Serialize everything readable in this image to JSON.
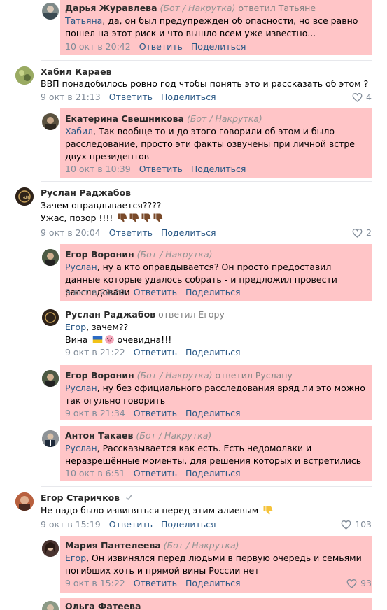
{
  "comments": [
    {
      "author": "Дарья Журавлева",
      "bot_tag": "(Бот / Накрутка)",
      "replied": "ответил Татьяне",
      "mention": "Татьяна",
      "text": ", да, он был предупрежден об опасности, но все равно пошел на этот риск и что вышло всем уже известно...",
      "date": "10 окт в 20:42",
      "reply": "Ответить",
      "share": "Поделиться"
    },
    {
      "author": "Хабил Караев",
      "text": "ВВП понадобилось ровно год чтобы понять это и рассказать об этом ?",
      "date": "9 окт в 21:13",
      "reply": "Ответить",
      "share": "Поделиться",
      "likes": "4"
    },
    {
      "author": "Екатерина Свешникова",
      "bot_tag": "(Бот / Накрутка)",
      "mention": "Хабил",
      "text": ", Так вообще то и до этого говорили об этом и было расследование, просто эти факты озвучены при личной встре двух президентов",
      "date": "10 окт в 10:39",
      "reply": "Ответить",
      "share": "Поделиться"
    },
    {
      "author": "Руслан Раджабов",
      "text_line1": "Зачем оправдывается????",
      "text_line2": "Ужас, позор !!!! ",
      "date": "9 окт в 20:04",
      "reply": "Ответить",
      "share": "Поделиться",
      "likes": "2"
    },
    {
      "author": "Егор Воронин",
      "bot_tag": "(Бот / Накрутка)",
      "mention": "Руслан",
      "text": ", ну а кто оправдывается? Он просто предоставил данные которые удалось собрать - и предложил провести расследовани",
      "date": "9 окт в 20:20",
      "reply": "Ответить",
      "share": "Поделиться"
    },
    {
      "author": "Руслан Раджабов",
      "replied": "ответил Егору",
      "mention": "Егор",
      "text_line1": ", зачем??",
      "text_line2a": "Вина ",
      "text_line2b": " очевидна!!!",
      "date": "9 окт в 21:22",
      "reply": "Ответить",
      "share": "Поделиться"
    },
    {
      "author": "Егор Воронин",
      "bot_tag": "(Бот / Накрутка)",
      "replied": "ответил Руслану",
      "mention": "Руслан",
      "text": ", ну без официального расследования вряд ли это можно так огульно говорить",
      "date": "9 окт в 21:34",
      "reply": "Ответить",
      "share": "Поделиться"
    },
    {
      "author": "Антон Такаев",
      "bot_tag": "(Бот / Накрутка)",
      "mention": "Руслан",
      "text": ", Рассказывается как есть. Есть недомолвки и неразрешённые моменты, для решения которых и встретились",
      "date": "10 окт в 6:51",
      "reply": "Ответить",
      "share": "Поделиться"
    },
    {
      "author": "Егор Старичков",
      "text": "Не надо было извиняться перед этим алиевым ",
      "date": "9 окт в 15:19",
      "reply": "Ответить",
      "share": "Поделиться",
      "likes": "103"
    },
    {
      "author": "Мария Пантелеева",
      "bot_tag": "(Бот / Накрутка)",
      "mention": "Егор",
      "text": ", Он извинялся перед людьми в первую очередь и семьями погибших хоть и прямой вины России нет",
      "date": "9 окт в 15:22",
      "reply": "Ответить",
      "share": "Поделиться",
      "likes": "93"
    },
    {
      "author": "Ольга Фатеева"
    }
  ],
  "colors": {
    "bot_highlight": "#ffc5c7",
    "link": "#2a5885",
    "meta": "#818c99"
  },
  "icons": {
    "like": "heart-icon",
    "dislike": "thumbs-down-icon",
    "verified": "checkmark-icon",
    "flag": "ukraine-flag-icon",
    "pig": "pig-face-icon"
  }
}
